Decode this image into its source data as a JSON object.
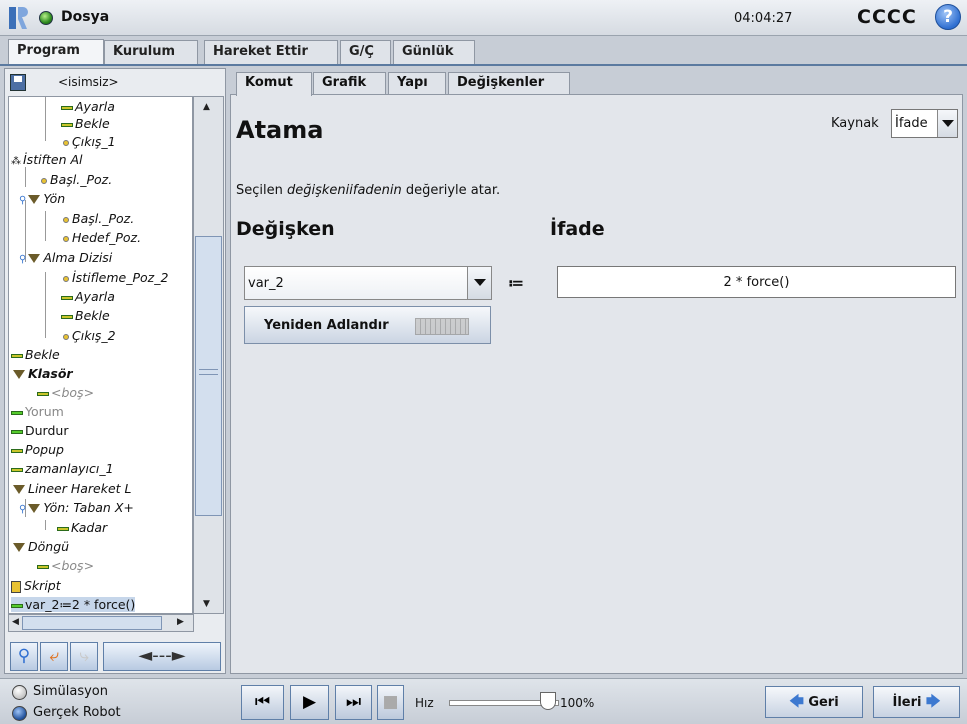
{
  "header": {
    "app_title": "Dosya",
    "clock": "04:04:27",
    "robot_name": "CCCC",
    "help_glyph": "?"
  },
  "main_tabs": [
    {
      "label": "Program",
      "active": true
    },
    {
      "label": "Kurulum"
    },
    {
      "label": "Hareket Ettir"
    },
    {
      "label": "G/Ç"
    },
    {
      "label": "Günlük"
    }
  ],
  "left": {
    "file_name": "<isimsiz>",
    "tree": [
      {
        "label": "Ayarla",
        "icon": "set-icon"
      },
      {
        "label": "Bekle",
        "icon": "wait-icon"
      },
      {
        "label": "Çıkış_1",
        "icon": "waypoint-icon"
      },
      {
        "label": "İstiften Al",
        "icon": "pallet-icon"
      },
      {
        "label": "Başl._Poz.",
        "icon": "waypoint-icon"
      },
      {
        "label": "Yön",
        "icon": "folder-icon"
      },
      {
        "label": "Başl._Poz.",
        "icon": "waypoint-icon"
      },
      {
        "label": "Hedef_Poz.",
        "icon": "waypoint-icon"
      },
      {
        "label": "Alma Dizisi",
        "icon": "folder-icon"
      },
      {
        "label": "İstifleme_Poz_2",
        "icon": "waypoint-icon"
      },
      {
        "label": "Ayarla",
        "icon": "set-icon"
      },
      {
        "label": "Bekle",
        "icon": "wait-icon"
      },
      {
        "label": "Çıkış_2",
        "icon": "waypoint-icon"
      },
      {
        "label": "Bekle",
        "icon": "wait-icon"
      },
      {
        "label": "Klasör",
        "icon": "folder-icon"
      },
      {
        "label": "<boş>",
        "icon": "empty-icon"
      },
      {
        "label": "Yorum",
        "icon": "comment-icon"
      },
      {
        "label": "Durdur",
        "icon": "halt-icon"
      },
      {
        "label": "Popup",
        "icon": "popup-icon"
      },
      {
        "label": "zamanlayıcı_1",
        "icon": "timer-icon"
      },
      {
        "label": "Lineer Hareket L",
        "icon": "move-icon"
      },
      {
        "label": "Yön: Taban X+",
        "icon": "direction-icon"
      },
      {
        "label": "Kadar",
        "icon": "until-icon"
      },
      {
        "label": "Döngü",
        "icon": "loop-icon"
      },
      {
        "label": "<boş>",
        "icon": "empty-icon"
      },
      {
        "label": "Skript",
        "icon": "script-icon"
      },
      {
        "label": "var_2≔2 * force()",
        "icon": "assignment-icon"
      }
    ],
    "arrow_glyph": "◄---►"
  },
  "sub_tabs": [
    {
      "label": "Komut",
      "active": true
    },
    {
      "label": "Grafik"
    },
    {
      "label": "Yapı"
    },
    {
      "label": "Değişkenler"
    }
  ],
  "command": {
    "title": "Atama",
    "source_label": "Kaynak",
    "source_value": "İfade",
    "desc_prefix": "Seçilen ",
    "desc_italic": "değişkeniifadenin",
    "desc_suffix": " değeriyle atar.",
    "var_heading": "Değişken",
    "expr_heading": "İfade",
    "var_value": "var_2",
    "assign_op": "≔",
    "expr_value": "2 * force()",
    "rename_label": "Yeniden Adlandır"
  },
  "bottom": {
    "sim_label": "Simülasyon",
    "real_label": "Gerçek Robot",
    "speed_label": "Hız",
    "speed_value": "100%",
    "speed_fraction": 1.0,
    "back_label": "Geri",
    "next_label": "İleri"
  },
  "colors": {
    "accent": "#3d79d0",
    "status_green": "#2e8b1f",
    "selection": "#c6d6ea"
  }
}
